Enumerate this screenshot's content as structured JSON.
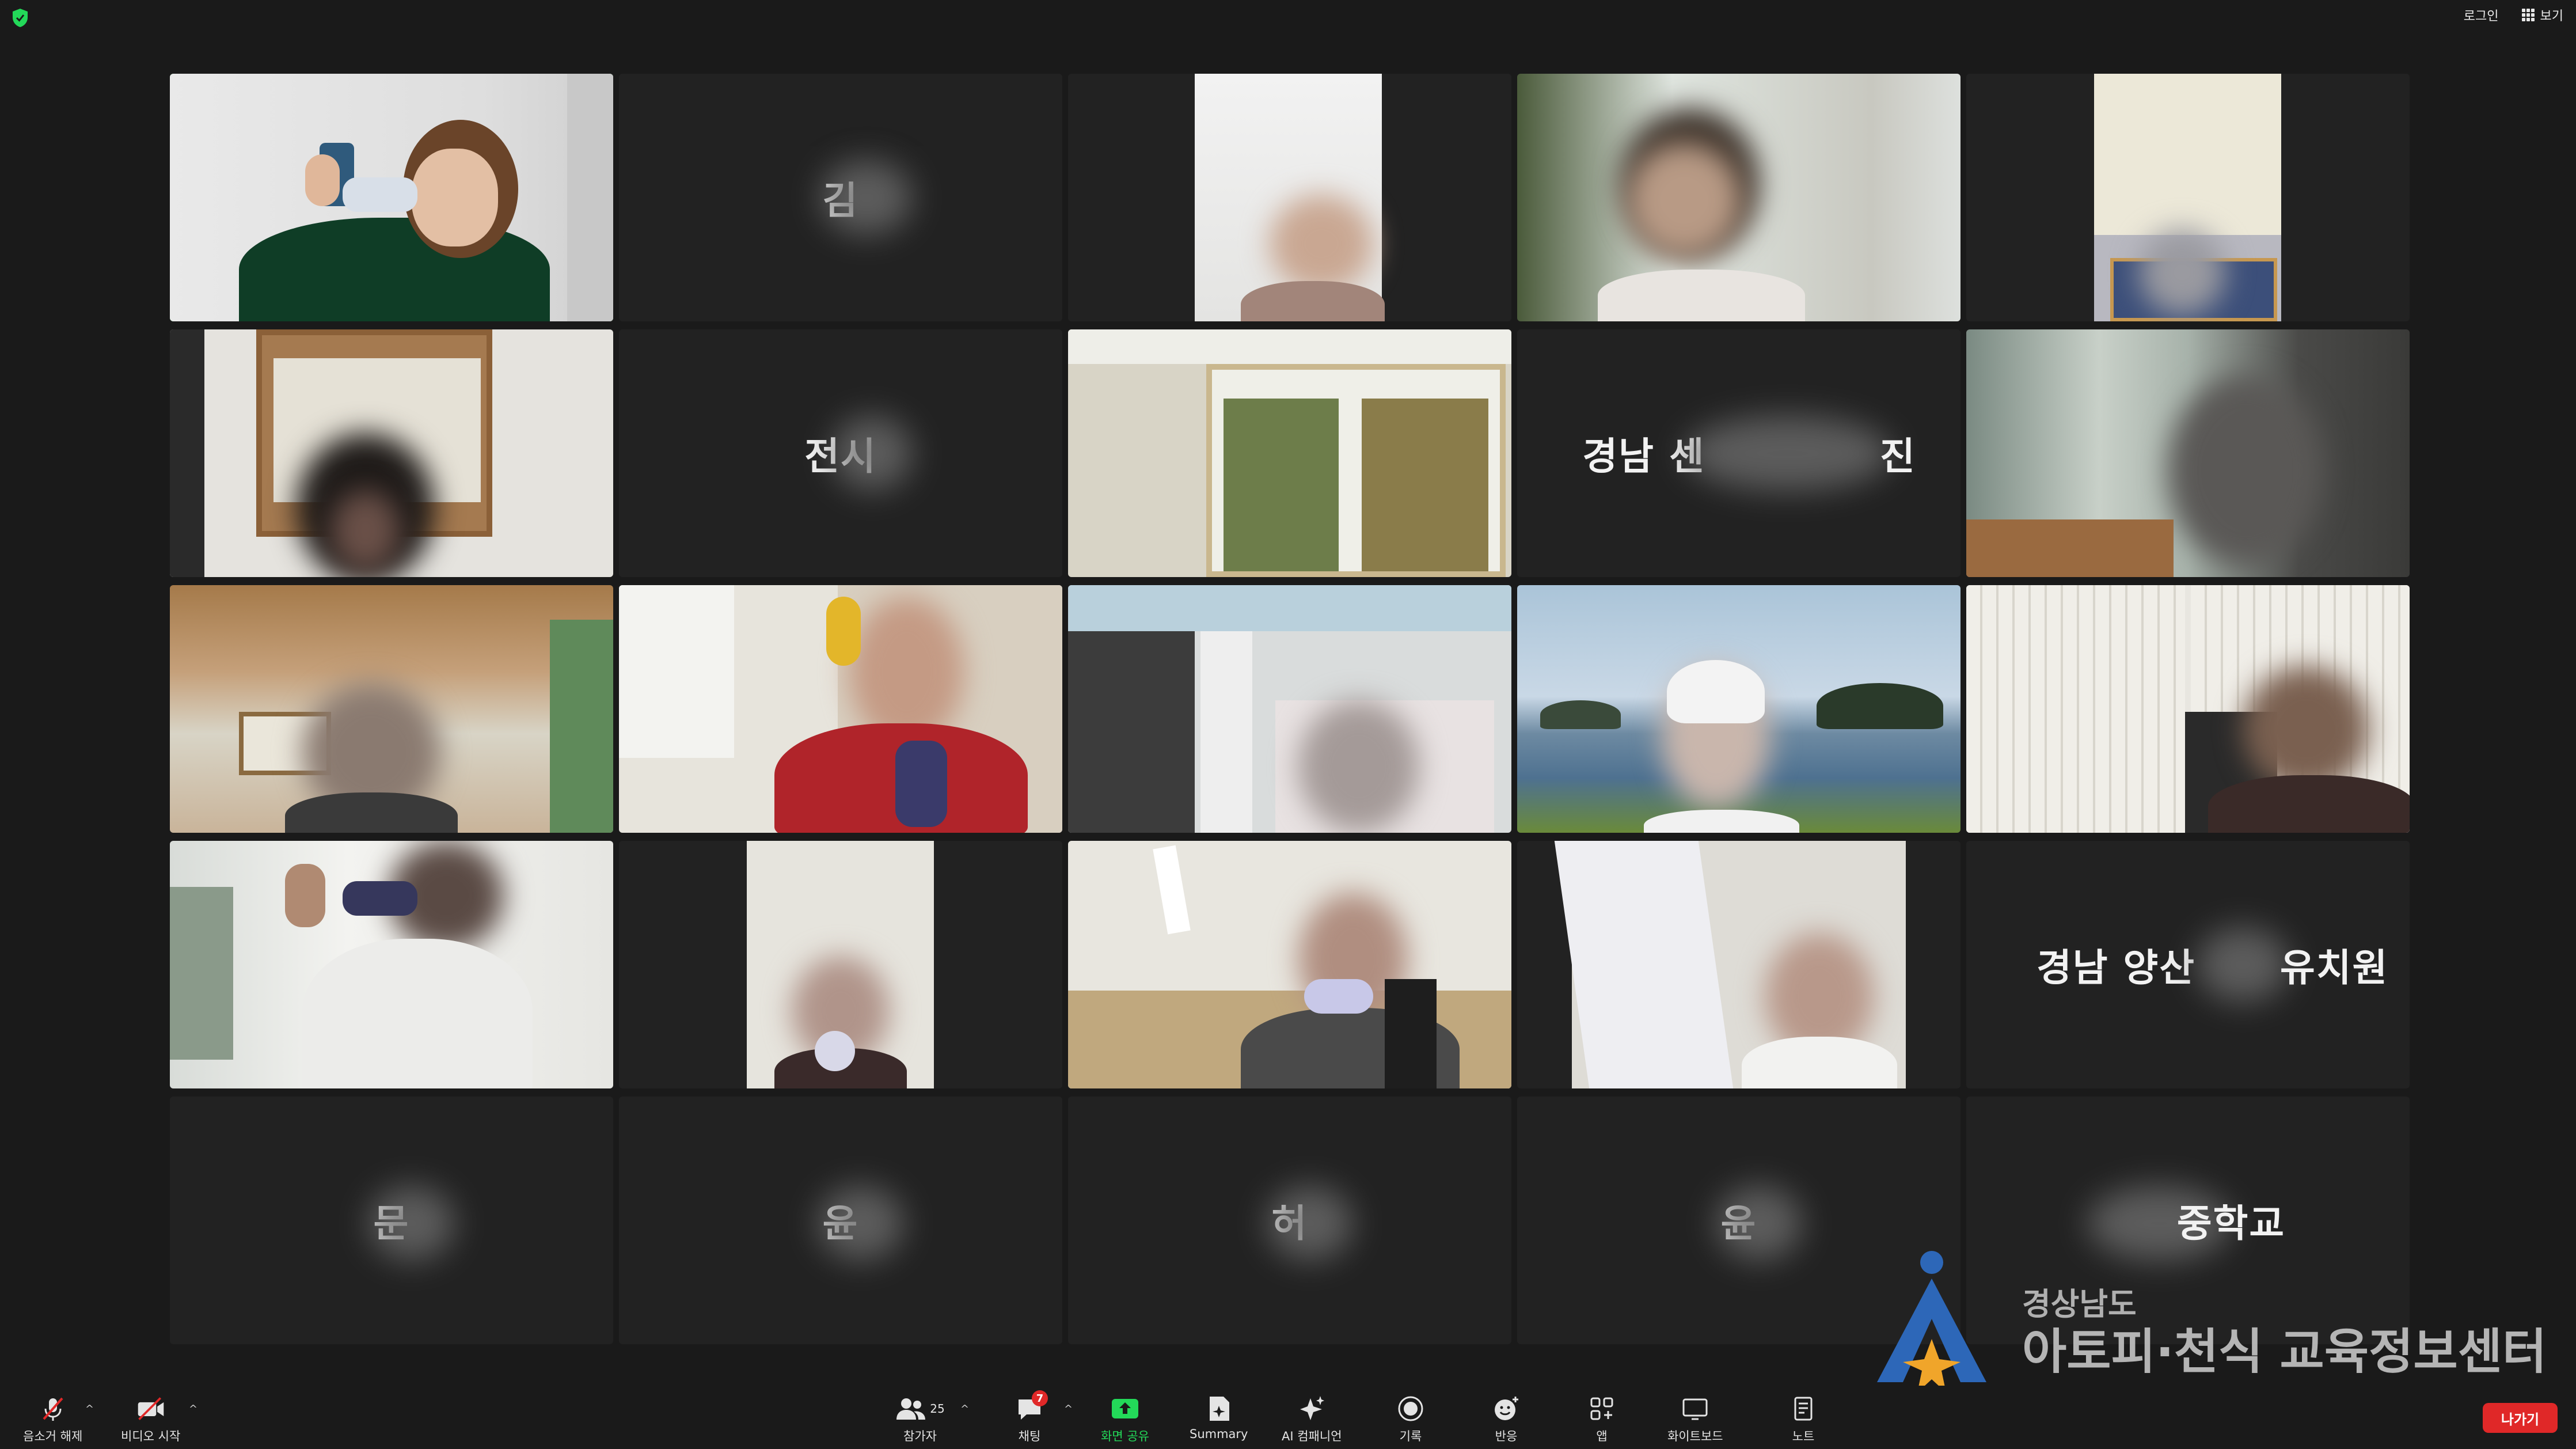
{
  "window": {
    "login_label": "로그인",
    "view_label": "보기"
  },
  "tiles": [
    {
      "type": "video",
      "name": "presenter",
      "scene": "office-white",
      "active": true
    },
    {
      "type": "name",
      "label": "김"
    },
    {
      "type": "video",
      "scene": "white-wall-portrait"
    },
    {
      "type": "video",
      "scene": "green-room"
    },
    {
      "type": "video",
      "scene": "ceiling-portrait"
    },
    {
      "type": "video",
      "scene": "bulletin-board"
    },
    {
      "type": "name",
      "label": "전시"
    },
    {
      "type": "video",
      "scene": "windows"
    },
    {
      "type": "name",
      "label_left": "경남 센",
      "label_right": "진"
    },
    {
      "type": "video",
      "scene": "window-blur"
    },
    {
      "type": "video",
      "scene": "wood-room"
    },
    {
      "type": "video",
      "scene": "sunflower-room"
    },
    {
      "type": "video",
      "scene": "classroom"
    },
    {
      "type": "video",
      "scene": "seaside"
    },
    {
      "type": "video",
      "scene": "closet"
    },
    {
      "type": "video",
      "scene": "window-room"
    },
    {
      "type": "video",
      "scene": "white-portrait"
    },
    {
      "type": "video",
      "scene": "office-man"
    },
    {
      "type": "video",
      "scene": "curtain-portrait"
    },
    {
      "type": "name",
      "label_left": "경남 양산",
      "label_right": "유치원"
    },
    {
      "type": "name",
      "label": "문"
    },
    {
      "type": "name",
      "label": "윤"
    },
    {
      "type": "name",
      "label": "허"
    },
    {
      "type": "name",
      "label": "윤"
    },
    {
      "type": "name",
      "label_right": "중학교"
    }
  ],
  "logo": {
    "small": "경상남도",
    "big": "아토피·천식 교육정보센터"
  },
  "toolbar": {
    "unmute": "음소거 해제",
    "start_video": "비디오 시작",
    "participants": "참가자",
    "participants_count": "25",
    "chat": "채팅",
    "chat_badge": "7",
    "share_screen": "화면 공유",
    "summary": "Summary",
    "ai_companion": "AI 컴패니언",
    "record": "기록",
    "reactions": "반응",
    "apps": "앱",
    "whiteboard": "화이트보드",
    "notes": "노트",
    "leave": "나가기"
  },
  "colors": {
    "background": "#1a1a1a",
    "tile": "#222222",
    "active_border": "#23d959",
    "leave": "#e02828",
    "share": "#23d959"
  }
}
